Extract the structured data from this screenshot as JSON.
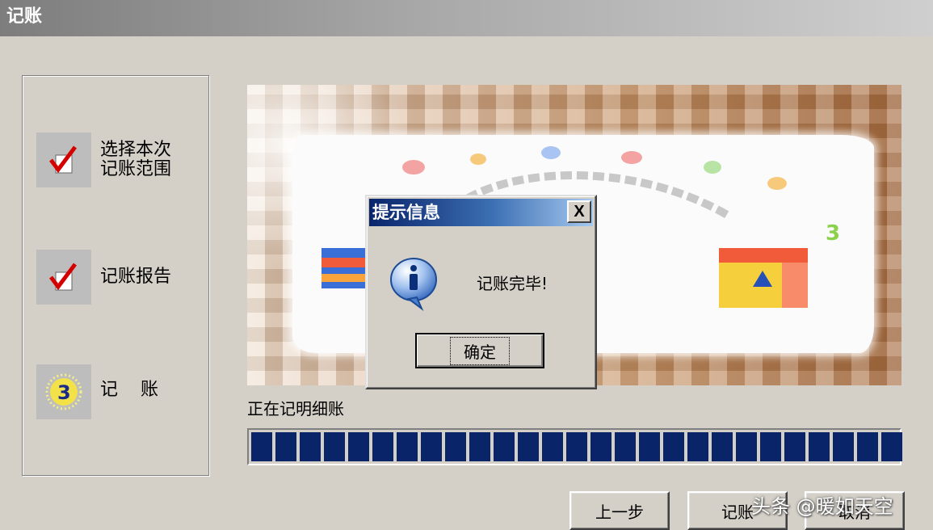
{
  "window": {
    "title": "记账"
  },
  "steps": [
    {
      "line1": "选择本次",
      "line2": "记账范围",
      "icon": "checkmark-document-icon"
    },
    {
      "label": "记账报告",
      "icon": "checkmark-report-icon"
    },
    {
      "label": "记    账",
      "icon": "step-3-sparkle-icon"
    }
  ],
  "progress": {
    "label": "正在记明细账",
    "segments_filled": 27
  },
  "buttons": {
    "prev": "上一步",
    "post": "记账",
    "cancel": "取消"
  },
  "dialog": {
    "title": "提示信息",
    "close_glyph": "X",
    "icon": "info-icon",
    "message": "记账完毕!",
    "ok_label": "确定"
  },
  "watermark": "头条 @暖如天空",
  "colors": {
    "titlebar_inactive": "#8e8e8e",
    "dialog_title": "#0a246a",
    "progress_fill": "#0a246a",
    "face": "#d4d0c8"
  }
}
